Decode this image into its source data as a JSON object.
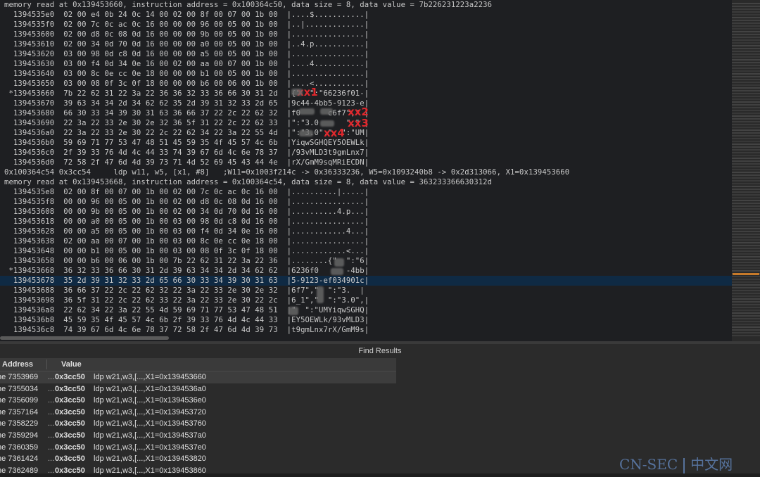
{
  "trace": {
    "lines": [
      {
        "t": "memory read at 0x139453660, instruction address = 0x100364c50, data size = 8, data value = 7b226231223a2236"
      },
      {
        "t": "  1394535e0  02 00 e4 0b 24 0c 14 00 02 00 8f 00 07 00 1b 00  |....$...........|"
      },
      {
        "t": "  1394535f0  02 00 7c 0c ac 0c 16 00 00 00 96 00 05 00 1b 00  |..|.............|"
      },
      {
        "t": "  139453600  02 00 d8 0c 08 0d 16 00 00 00 9b 00 05 00 1b 00  |................|"
      },
      {
        "t": "  139453610  02 00 34 0d 70 0d 16 00 00 00 a0 00 05 00 1b 00  |..4.p...........|"
      },
      {
        "t": "  139453620  03 00 98 0d c8 0d 16 00 00 00 a5 00 05 00 1b 00  |................|"
      },
      {
        "t": "  139453630  03 00 f4 0d 34 0e 16 00 02 00 aa 00 07 00 1b 00  |....4...........|"
      },
      {
        "t": "  139453640  03 00 8c 0e cc 0e 18 00 00 00 b1 00 05 00 1b 00  |................|"
      },
      {
        "t": "  139453650  03 00 08 0f 3c 0f 18 00 00 00 b6 00 06 00 1b 00  |....<...........|"
      },
      {
        "t": " *139453660  7b 22 62 31 22 3a 22 36 36 32 33 36 66 30 31 2d  |{\"  \":\"66236f01-|"
      },
      {
        "t": "  139453670  39 63 34 34 2d 34 62 62 35 2d 39 31 32 33 2d 65  |9c44-4bb5-9123-e|"
      },
      {
        "t": "  139453680  66 30 33 34 39 30 31 63 36 66 37 22 2c 22 62 32  |f0      c6f7\",\" |"
      },
      {
        "t": "  139453690  22 3a 22 33 2e 30 2e 32 36 5f 31 22 2c 22 62 33  |\":\"3.0      \",\" |"
      },
      {
        "t": "  1394536a0  22 3a 22 33 2e 30 22 2c 22 62 34 22 3a 22 55 4d  |\":\"3.0\",\"  \":\"UM|"
      },
      {
        "t": "  1394536b0  59 69 71 77 53 47 48 51 45 59 35 4f 45 57 4c 6b  |YiqwSGHQEY5OEWLk|"
      },
      {
        "t": "  1394536c0  2f 39 33 76 4d 4c 44 33 74 39 67 6d 4c 6e 78 37  |/93vMLD3t9gmLnx7|"
      },
      {
        "t": "  1394536d0  72 58 2f 47 6d 4d 39 73 71 4d 52 69 45 43 44 4e  |rX/GmM9sqMRiECDN|"
      },
      {
        "t": "0x100364c54 0x3cc54     ldp w11, w5, [x1, #8]   ;W11=0x1003f214c -> 0x36333236, W5=0x1093240b8 -> 0x2d313066, X1=0x139453660"
      },
      {
        "t": "memory read at 0x139453668, instruction address = 0x100364c54, data size = 8, data value = 363233366630312d"
      },
      {
        "t": "  1394535e8  02 00 8f 00 07 00 1b 00 02 00 7c 0c ac 0c 16 00  |..........|.....|"
      },
      {
        "t": "  1394535f8  00 00 96 00 05 00 1b 00 02 00 d8 0c 08 0d 16 00  |................|"
      },
      {
        "t": "  139453608  00 00 9b 00 05 00 1b 00 02 00 34 0d 70 0d 16 00  |..........4.p...|"
      },
      {
        "t": "  139453618  00 00 a0 00 05 00 1b 00 03 00 98 0d c8 0d 16 00  |................|"
      },
      {
        "t": "  139453628  00 00 a5 00 05 00 1b 00 03 00 f4 0d 34 0e 16 00  |............4...|"
      },
      {
        "t": "  139453638  02 00 aa 00 07 00 1b 00 03 00 8c 0e cc 0e 18 00  |................|"
      },
      {
        "t": "  139453648  00 00 b1 00 05 00 1b 00 03 00 08 0f 3c 0f 18 00  |............<...|"
      },
      {
        "t": "  139453658  00 00 b6 00 06 00 1b 00 7b 22 62 31 22 3a 22 36  |........{\"  \":\"6|"
      },
      {
        "t": " *139453668  36 32 33 36 66 30 31 2d 39 63 34 34 2d 34 62 62  |6236f0      -4bb|"
      },
      {
        "t": "  139453678  35 2d 39 31 32 33 2d 65 66 30 33 34 39 30 31 63  |5-9123-ef034901c|",
        "hl": true
      },
      {
        "t": "  139453688  36 66 37 22 2c 22 62 32 22 3a 22 33 2e 30 2e 32  |6f7\",\"  \":\"3.  |"
      },
      {
        "t": "  139453698  36 5f 31 22 2c 22 62 33 22 3a 22 33 2e 30 22 2c  |6_1\",\"  \":\"3.0\",|"
      },
      {
        "t": "  1394536a8  22 62 34 22 3a 22 55 4d 59 69 71 77 53 47 48 51  |\"  \":\"UMYiqwSGHQ|"
      },
      {
        "t": "  1394536b8  45 59 35 4f 45 57 4c 6b 2f 39 33 76 4d 4c 44 33  |EY5OEWLk/93vMLD3|"
      },
      {
        "t": "  1394536c8  74 39 67 6d 4c 6e 78 37 72 58 2f 47 6d 4d 39 73  |t9gmLnx7rX/GmM9s|"
      }
    ],
    "annotations": [
      "xx1",
      "xx2",
      "xx3",
      "xx4"
    ]
  },
  "find": {
    "title": "Find Results",
    "columns": [
      "Address",
      "Value"
    ],
    "rows": [
      {
        "addr": "ne 7353969",
        "dots": "...",
        "off": "0x3cc50",
        "val": "ldp w21,w3,[...,X1=0x139453660",
        "sel": true
      },
      {
        "addr": "ne 7355034",
        "dots": "...",
        "off": "0x3cc50",
        "val": "ldp w21,w3,[...,X1=0x1394536a0"
      },
      {
        "addr": "ne 7356099",
        "dots": "...",
        "off": "0x3cc50",
        "val": "ldp w21,w3,[...,X1=0x1394536e0"
      },
      {
        "addr": "ne 7357164",
        "dots": "...",
        "off": "0x3cc50",
        "val": "ldp w21,w3,[...,X1=0x139453720"
      },
      {
        "addr": "ne 7358229",
        "dots": "...",
        "off": "0x3cc50",
        "val": "ldp w21,w3,[...,X1=0x139453760"
      },
      {
        "addr": "ne 7359294",
        "dots": "...",
        "off": "0x3cc50",
        "val": "ldp w21,w3,[...,X1=0x1394537a0"
      },
      {
        "addr": "ne 7360359",
        "dots": "...",
        "off": "0x3cc50",
        "val": "ldp w21,w3,[...,X1=0x1394537e0"
      },
      {
        "addr": "ne 7361424",
        "dots": "...",
        "off": "0x3cc50",
        "val": "ldp w21,w3,[...,X1=0x139453820"
      },
      {
        "addr": "ne 7362489",
        "dots": "...",
        "off": "0x3cc50",
        "val": "ldp w21,w3,[...,X1=0x139453860"
      }
    ]
  },
  "watermark": {
    "left": "CN-SEC",
    "right": "中文网"
  },
  "colors": {
    "highlight_row": "#0f2a44",
    "annotation": "#e0282d",
    "ascii_highlight": "#d7d700",
    "minimap_mark": "#c77a2a"
  }
}
